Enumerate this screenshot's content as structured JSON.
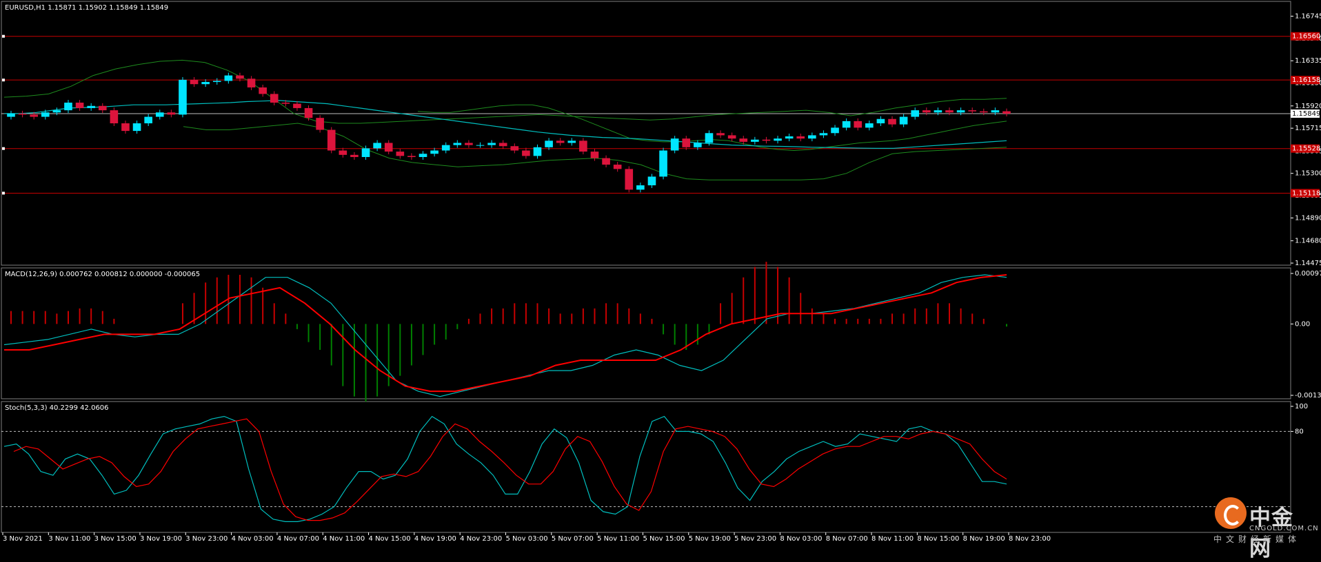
{
  "chart_data": [
    {
      "type": "candlestick",
      "title": "EURUSD,H1  1.15871 1.15902 1.15849 1.15849",
      "ylim": [
        1.14475,
        1.16805
      ],
      "y_ticks": [
        "1.16745",
        "1.16540",
        "1.16335",
        "1.16130",
        "1.15920",
        "1.15715",
        "1.15505",
        "1.15300",
        "1.15095",
        "1.14890",
        "1.14680",
        "1.14475"
      ],
      "current_price": "1.15849",
      "level_lines": [
        {
          "label": "1.16560",
          "value": 1.1656
        },
        {
          "label": "1.16158",
          "value": 1.16158
        },
        {
          "label": "1.15528",
          "value": 1.15528
        },
        {
          "label": "1.15118",
          "value": 1.15118
        }
      ],
      "candles_close": [
        1.1585,
        1.1584,
        1.1582,
        1.1586,
        1.1588,
        1.1595,
        1.159,
        1.1592,
        1.1588,
        1.1576,
        1.1569,
        1.1576,
        1.1582,
        1.1586,
        1.1584,
        1.1616,
        1.1612,
        1.1614,
        1.1615,
        1.162,
        1.1617,
        1.1609,
        1.1603,
        1.1595,
        1.1594,
        1.159,
        1.1581,
        1.157,
        1.1551,
        1.1547,
        1.1545,
        1.1553,
        1.1558,
        1.155,
        1.1546,
        1.1545,
        1.1548,
        1.1551,
        1.1556,
        1.1558,
        1.1556,
        1.1556,
        1.1558,
        1.1555,
        1.1551,
        1.1546,
        1.1554,
        1.156,
        1.1558,
        1.156,
        1.155,
        1.1544,
        1.1538,
        1.1534,
        1.1515,
        1.1519,
        1.1527,
        1.1551,
        1.1562,
        1.1554,
        1.1558,
        1.1567,
        1.1565,
        1.1562,
        1.1559,
        1.1561,
        1.156,
        1.1562,
        1.1564,
        1.1562,
        1.1565,
        1.1567,
        1.1572,
        1.1578,
        1.1572,
        1.1576,
        1.158,
        1.1575,
        1.1582,
        1.1588,
        1.1586,
        1.1588,
        1.1586,
        1.1588,
        1.1587,
        1.1586,
        1.1588,
        1.15849
      ],
      "candles_open": [
        1.1582,
        1.1585,
        1.1584,
        1.1582,
        1.1586,
        1.1588,
        1.1595,
        1.159,
        1.1592,
        1.1588,
        1.1576,
        1.1569,
        1.1576,
        1.1582,
        1.1586,
        1.1584,
        1.1616,
        1.1612,
        1.1614,
        1.1615,
        1.162,
        1.1617,
        1.1609,
        1.1603,
        1.1595,
        1.1594,
        1.159,
        1.1581,
        1.157,
        1.1551,
        1.1547,
        1.1545,
        1.1553,
        1.1558,
        1.155,
        1.1546,
        1.1545,
        1.1548,
        1.1551,
        1.1556,
        1.1558,
        1.1556,
        1.1556,
        1.1558,
        1.1555,
        1.1551,
        1.1546,
        1.1554,
        1.156,
        1.1558,
        1.156,
        1.155,
        1.1544,
        1.1538,
        1.1534,
        1.1515,
        1.1519,
        1.1527,
        1.1551,
        1.1562,
        1.1554,
        1.1558,
        1.1567,
        1.1565,
        1.1562,
        1.1559,
        1.1561,
        1.156,
        1.1562,
        1.1564,
        1.1562,
        1.1565,
        1.1567,
        1.1572,
        1.1578,
        1.1572,
        1.1576,
        1.158,
        1.1575,
        1.1582,
        1.1588,
        1.1586,
        1.1588,
        1.1586,
        1.1588,
        1.1587,
        1.1586,
        1.15871
      ],
      "ma_values": [
        1.1585,
        1.1585,
        1.1586,
        1.1588,
        1.159,
        1.15905,
        1.1591,
        1.1592,
        1.1593,
        1.1593,
        1.1593,
        1.15935,
        1.1594,
        1.15945,
        1.1595,
        1.1596,
        1.15965,
        1.1597,
        1.1596,
        1.1595,
        1.1594,
        1.1592,
        1.159,
        1.1588,
        1.1586,
        1.1584,
        1.1582,
        1.158,
        1.1578,
        1.1576,
        1.1574,
        1.1572,
        1.157,
        1.1568,
        1.15665,
        1.1565,
        1.1564,
        1.1563,
        1.15625,
        1.1562,
        1.1561,
        1.156,
        1.1559,
        1.1558,
        1.1557,
        1.1556,
        1.15555,
        1.1555,
        1.15548,
        1.15545,
        1.1554,
        1.15538,
        1.15535,
        1.15532,
        1.1553,
        1.1553,
        1.1554,
        1.1555,
        1.1556,
        1.1557,
        1.1558,
        1.1559,
        1.156
      ],
      "bb_upper": [
        1.16,
        1.1601,
        1.1603,
        1.161,
        1.162,
        1.1626,
        1.163,
        1.1633,
        1.1634,
        1.1632,
        1.1625,
        1.1615,
        1.16,
        1.1585,
        1.1578,
        1.1576,
        1.1576,
        1.1577,
        1.1578,
        1.1579,
        1.158,
        1.1581,
        1.1582,
        1.1583,
        1.1584,
        1.1583,
        1.1582,
        1.1581,
        1.158,
        1.1579,
        1.158,
        1.1582,
        1.1584,
        1.1585,
        1.1586,
        1.1587,
        1.1588,
        1.1586,
        1.1583,
        1.1586,
        1.159,
        1.1593,
        1.1596,
        1.1598,
        1.1598,
        1.1599
      ],
      "bb_lower": [
        1.1573,
        1.157,
        1.157,
        1.1572,
        1.1574,
        1.1576,
        1.1572,
        1.1564,
        1.1552,
        1.1544,
        1.154,
        1.1538,
        1.1536,
        1.1537,
        1.1538,
        1.154,
        1.1542,
        1.1543,
        1.1544,
        1.1542,
        1.1538,
        1.153,
        1.1525,
        1.1524,
        1.1524,
        1.1524,
        1.1524,
        1.1524,
        1.1525,
        1.153,
        1.154,
        1.1548,
        1.155,
        1.1551,
        1.1552,
        1.1553,
        1.1554
      ],
      "bb_mid": [
        1.1587,
        1.1586,
        1.1586,
        1.1588,
        1.159,
        1.1592,
        1.1593,
        1.1593,
        1.159,
        1.1585,
        1.158,
        1.1574,
        1.1568,
        1.1562,
        1.156,
        1.1559,
        1.1559,
        1.156,
        1.1561,
        1.156,
        1.1557,
        1.1554,
        1.1552,
        1.1551,
        1.1552,
        1.1554,
        1.1556,
        1.1558,
        1.1559,
        1.156,
        1.1562,
        1.1565,
        1.1568,
        1.1571,
        1.1574,
        1.1576,
        1.1578
      ]
    },
    {
      "type": "macd",
      "title": "MACD(12,26,9) 0.000762 0.000812 0.000000 -0.000065",
      "ylim": [
        -0.001378,
        0.000976
      ],
      "y_ticks": [
        "0.000976",
        "0.00",
        "-0.001378"
      ],
      "histogram": [
        0.00025,
        0.00025,
        0.00025,
        0.00025,
        0.0002,
        0.00025,
        0.0003,
        0.0003,
        0.00025,
        0.0001,
        0.0,
        0.0,
        0.0,
        0.0,
        0.0,
        0.0004,
        0.0006,
        0.0008,
        0.0009,
        0.00095,
        0.00095,
        0.0009,
        0.0007,
        0.0004,
        0.0002,
        -0.0001,
        -0.00035,
        -0.0005,
        -0.0008,
        -0.0012,
        -0.0014,
        -0.0015,
        -0.0014,
        -0.0012,
        -0.001,
        -0.0008,
        -0.0006,
        -0.0004,
        -0.0003,
        -0.0001,
        0.0001,
        0.0002,
        0.0003,
        0.0003,
        0.0004,
        0.0004,
        0.0004,
        0.0003,
        0.0002,
        0.0002,
        0.0003,
        0.0003,
        0.0004,
        0.0004,
        0.0003,
        0.0002,
        0.0001,
        -0.0002,
        -0.0004,
        -0.0005,
        -0.0004,
        -0.0002,
        0.0004,
        0.0006,
        0.0009,
        0.0011,
        0.0012,
        0.0011,
        0.0009,
        0.0006,
        0.0003,
        0.0002,
        0.0001,
        0.0001,
        0.0001,
        0.0001,
        0.0001,
        0.0002,
        0.0002,
        0.0003,
        0.0003,
        0.0004,
        0.0004,
        0.0003,
        0.0002,
        0.0001,
        0.0,
        -5e-05
      ],
      "macd_line": [
        -0.0004,
        -0.00035,
        -0.0003,
        -0.0002,
        -0.0001,
        -0.0002,
        -0.00025,
        -0.0002,
        -0.0002,
        0.0,
        0.0003,
        0.0006,
        0.0009,
        0.0009,
        0.0007,
        0.0004,
        -0.0001,
        -0.0006,
        -0.0011,
        -0.0013,
        -0.0014,
        -0.0013,
        -0.0012,
        -0.0011,
        -0.001,
        -0.0009,
        -0.0009,
        -0.0008,
        -0.0006,
        -0.0005,
        -0.0006,
        -0.0008,
        -0.0009,
        -0.0007,
        -0.0003,
        0.0001,
        0.0002,
        0.0002,
        0.00025,
        0.0003,
        0.0004,
        0.0005,
        0.0006,
        0.0008,
        0.0009,
        0.00095,
        0.0009
      ],
      "signal_line": [
        -0.0005,
        -0.0005,
        -0.0004,
        -0.0003,
        -0.0002,
        -0.0002,
        -0.0002,
        -0.0001,
        0.0002,
        0.0005,
        0.0006,
        0.0007,
        0.0004,
        0.0,
        -0.0005,
        -0.0009,
        -0.0012,
        -0.0013,
        -0.0013,
        -0.0012,
        -0.0011,
        -0.001,
        -0.0008,
        -0.0007,
        -0.0007,
        -0.0007,
        -0.0007,
        -0.0005,
        -0.0002,
        0.0,
        0.0001,
        0.0002,
        0.0002,
        0.0002,
        0.0003,
        0.0004,
        0.0005,
        0.0006,
        0.0008,
        0.0009,
        0.00095
      ]
    },
    {
      "type": "stochastic",
      "title": "Stoch(5,3,3) 40.2299 42.0606",
      "ylim": [
        0,
        100
      ],
      "y_ticks": [
        "100",
        "80"
      ],
      "levels": [
        80,
        20
      ],
      "k_line": [
        68,
        70,
        62,
        48,
        45,
        58,
        62,
        58,
        45,
        30,
        33,
        45,
        62,
        78,
        82,
        84,
        86,
        90,
        92,
        88,
        50,
        18,
        10,
        8,
        8,
        10,
        14,
        20,
        35,
        48,
        48,
        42,
        45,
        58,
        80,
        92,
        86,
        70,
        62,
        55,
        45,
        30,
        30,
        48,
        70,
        82,
        75,
        55,
        25,
        16,
        14,
        20,
        60,
        88,
        92,
        80,
        80,
        78,
        72,
        55,
        35,
        25,
        40,
        48,
        58,
        64,
        68,
        72,
        68,
        70,
        78,
        76,
        74,
        72,
        82,
        84,
        80,
        78,
        70,
        55,
        40,
        40,
        38
      ],
      "d_line": [
        64,
        68,
        66,
        58,
        50,
        54,
        58,
        60,
        55,
        44,
        36,
        38,
        48,
        64,
        74,
        82,
        84,
        86,
        88,
        90,
        80,
        48,
        22,
        12,
        9,
        9,
        11,
        15,
        24,
        34,
        44,
        46,
        44,
        48,
        60,
        76,
        86,
        82,
        72,
        64,
        55,
        45,
        38,
        38,
        48,
        66,
        76,
        72,
        56,
        36,
        22,
        17,
        32,
        64,
        82,
        84,
        82,
        80,
        76,
        66,
        50,
        38,
        36,
        42,
        50,
        56,
        62,
        66,
        68,
        68,
        72,
        76,
        76,
        74,
        78,
        80,
        78,
        74,
        70,
        58,
        48,
        42
      ]
    }
  ],
  "x_axis_labels": [
    "3 Nov 2021",
    "3 Nov 11:00",
    "3 Nov 15:00",
    "3 Nov 19:00",
    "3 Nov 23:00",
    "4 Nov 03:00",
    "4 Nov 07:00",
    "4 Nov 11:00",
    "4 Nov 15:00",
    "4 Nov 19:00",
    "4 Nov 23:00",
    "5 Nov 03:00",
    "5 Nov 07:00",
    "5 Nov 11:00",
    "5 Nov 15:00",
    "5 Nov 19:00",
    "5 Nov 23:00",
    "8 Nov 03:00",
    "8 Nov 07:00",
    "8 Nov 11:00",
    "8 Nov 15:00",
    "8 Nov 19:00",
    "8 Nov 23:00"
  ],
  "colors": {
    "bull": "#00e5ff",
    "bear": "#dc143c",
    "bb": "#1e8c1e",
    "ma": "#00bfbf",
    "level": "#c80000",
    "macd_hist_pos": "#c80000",
    "macd_hist_neg": "#008000",
    "macd_main": "#00bfbf",
    "macd_signal": "#ff0000",
    "stoch_k": "#00bfbf",
    "stoch_d": "#ff0000"
  },
  "watermark": {
    "title": "中金网",
    "url": "CNGOLD.COM.CN",
    "subtitle": "中文财经新媒体"
  }
}
